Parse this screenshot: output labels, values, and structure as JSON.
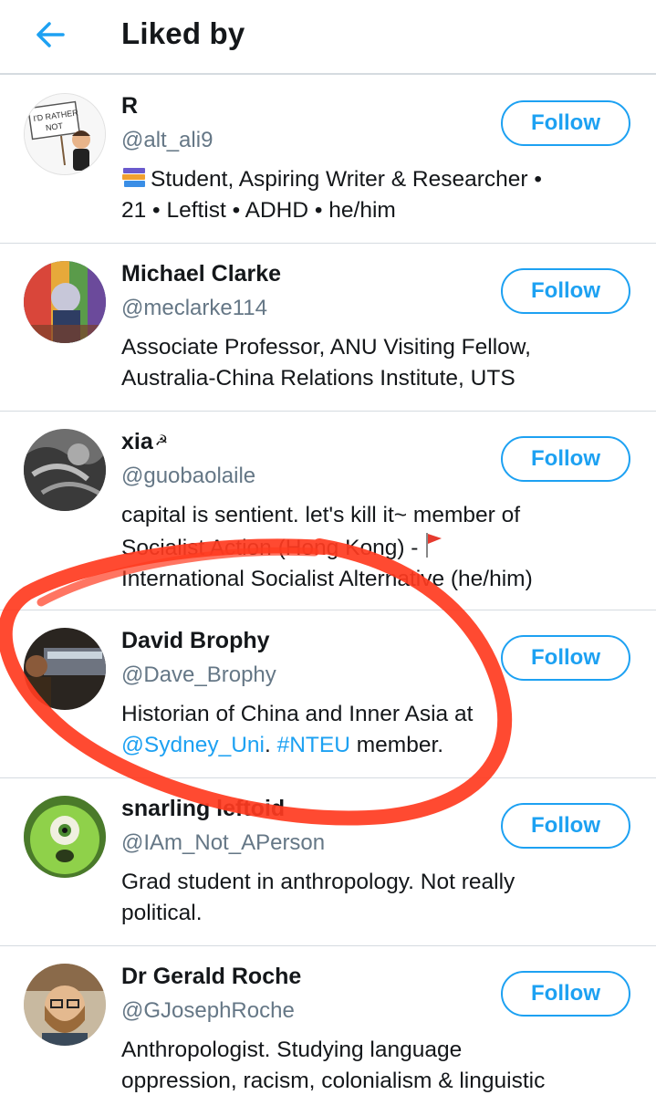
{
  "header": {
    "title": "Liked by"
  },
  "users": [
    {
      "name": "R",
      "handle": "@alt_ali9",
      "bio_line1": "Student, Aspiring Writer & Researcher •",
      "bio_line2": "21 • Leftist • ADHD • he/him",
      "avatar_sign_text_1": "I'D RATHER",
      "avatar_sign_text_2": "NOT",
      "follow_label": "Follow"
    },
    {
      "name": "Michael Clarke",
      "handle": "@meclarke114",
      "bio_line1": "Associate Professor, ANU Visiting Fellow,",
      "bio_line2": "Australia-China Relations Institute, UTS",
      "follow_label": "Follow"
    },
    {
      "name": "xia",
      "name_symbol": "☭",
      "handle": "@guobaolaile",
      "bio_line1": "capital is sentient. let's kill it~ member of",
      "bio_line2": "Socialist Action (Hong Kong) -",
      "bio_line3": "International Socialist Alternative (he/him)",
      "follow_label": "Follow"
    },
    {
      "name": "David Brophy",
      "handle": "@Dave_Brophy",
      "bio_line1": "Historian of China and Inner Asia at",
      "bio_link1": "@Sydney_Uni",
      "bio_sep": ".",
      "bio_link2": "#NTEU",
      "bio_tail": "member.",
      "follow_label": "Follow"
    },
    {
      "name": "snarling leftoid",
      "handle": "@IAm_Not_APerson",
      "bio_line1": "Grad student in anthropology. Not really",
      "bio_line2": "political.",
      "follow_label": "Follow"
    },
    {
      "name": "Dr Gerald Roche",
      "handle": "@GJosephRoche",
      "bio_line1": "Anthropologist. Studying language",
      "bio_line2": "oppression, racism, colonialism & linguistic",
      "follow_label": "Follow"
    }
  ],
  "colors": {
    "accent": "#1da1f2",
    "annotation": "#ff3b1f",
    "secondary_text": "#657786"
  }
}
